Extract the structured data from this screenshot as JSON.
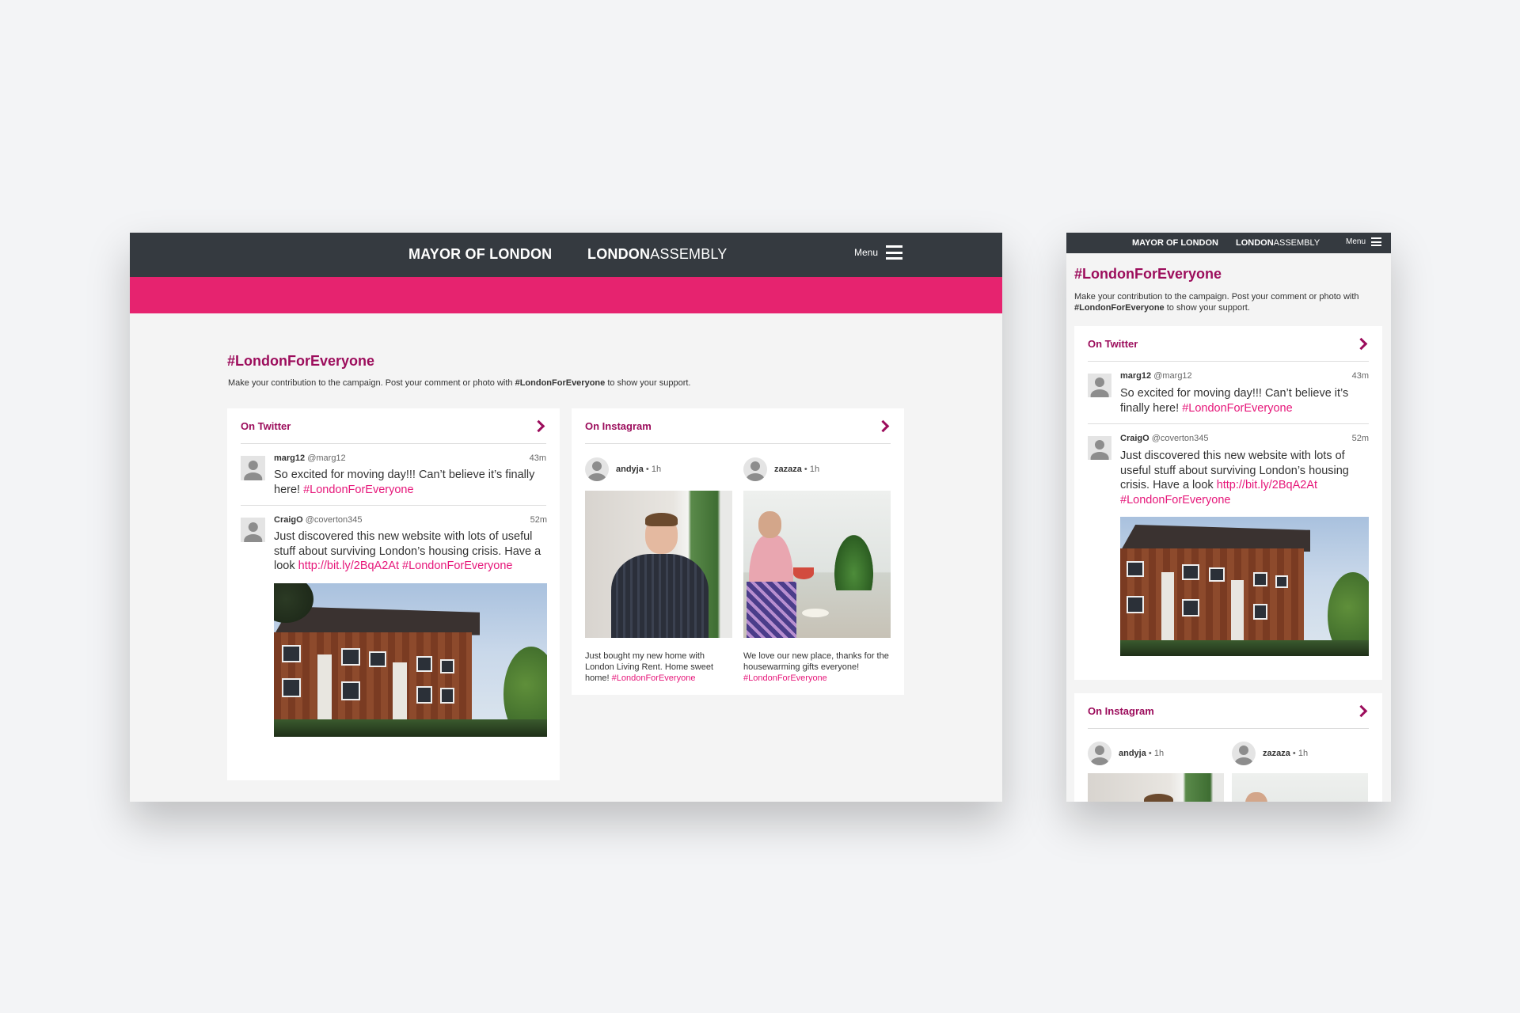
{
  "header": {
    "mayor_logo": "MAYOR OF LONDON",
    "assembly_logo_bold": "LONDON",
    "assembly_logo_light": "ASSEMBLY",
    "menu_label": "Menu"
  },
  "campaign": {
    "title": "#LondonForEveryone",
    "intro_before": "Make your contribution to the campaign. Post your comment or photo with ",
    "intro_hashtag": "#LondonForEveryone",
    "intro_after": " to show your support."
  },
  "twitter": {
    "label": "On Twitter",
    "tweets": [
      {
        "name": "marg12",
        "handle": "@marg12",
        "time": "43m",
        "text": "So excited for moving day!!! Can’t believe it’s finally here! ",
        "hashtag": "#LondonForEveryone"
      },
      {
        "name": "CraigO",
        "handle": "@coverton345",
        "time": "52m",
        "text": "Just discovered this new website with lots of useful stuff about surviving London’s housing crisis. Have a look ",
        "link": "http://bit.ly/2BqA2At",
        "hashtag": "#LondonForEveryone"
      }
    ]
  },
  "instagram": {
    "label": "On Instagram",
    "posts": [
      {
        "user": "andyja",
        "time": "• 1h",
        "caption": "Just bought my new home with London Living Rent. Home sweet home! ",
        "hashtag": "#LondonForEveryone"
      },
      {
        "user": "zazaza",
        "time": "• 1h",
        "caption": "We love our new place, thanks for the housewarming gifts everyone! ",
        "hashtag": "#LondonForEveryone"
      }
    ]
  },
  "colors": {
    "brand_magenta": "#9c0d5c",
    "accent_pink": "#e6236f",
    "link_pink": "#e6177a",
    "header_dark": "#353a40"
  }
}
